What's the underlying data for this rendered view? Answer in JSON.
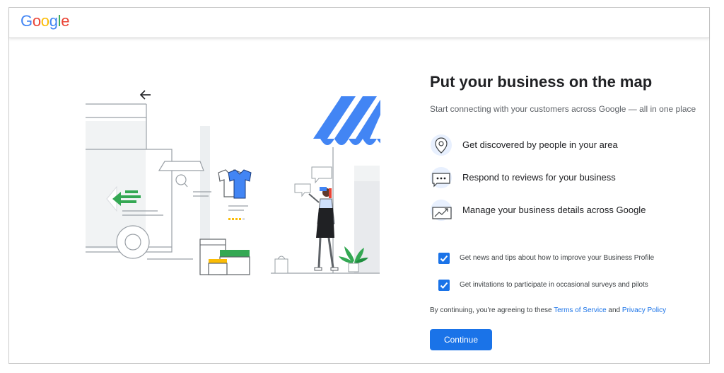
{
  "brand": {
    "logo_letters": [
      {
        "char": "G",
        "color": "#4285F4"
      },
      {
        "char": "o",
        "color": "#EA4335"
      },
      {
        "char": "o",
        "color": "#FBBC05"
      },
      {
        "char": "g",
        "color": "#4285F4"
      },
      {
        "char": "l",
        "color": "#34A853"
      },
      {
        "char": "e",
        "color": "#EA4335"
      }
    ]
  },
  "main": {
    "title": "Put your business on the map",
    "subtitle": "Start connecting with your customers across Google — all in one place",
    "features": [
      {
        "icon": "map-pin-icon",
        "label": "Get discovered by people in your area"
      },
      {
        "icon": "review-bubble-icon",
        "label": "Respond to reviews for your business"
      },
      {
        "icon": "chart-growth-icon",
        "label": "Manage your business details across Google"
      }
    ],
    "checkboxes": [
      {
        "label": "Get news and tips about how to improve your Business Profile",
        "checked": true
      },
      {
        "label": "Get invitations to participate in occasional surveys and pilots",
        "checked": true
      }
    ],
    "consent": {
      "prefix": "By continuing, you're agreeing to these ",
      "terms_link": "Terms of Service",
      "middle": " and ",
      "privacy_link": "Privacy Policy"
    },
    "continue_label": "Continue"
  },
  "colors": {
    "accent": "#1a73e8",
    "green": "#34A853",
    "yellow": "#FBBC05",
    "awning_blue": "#4285F4"
  }
}
